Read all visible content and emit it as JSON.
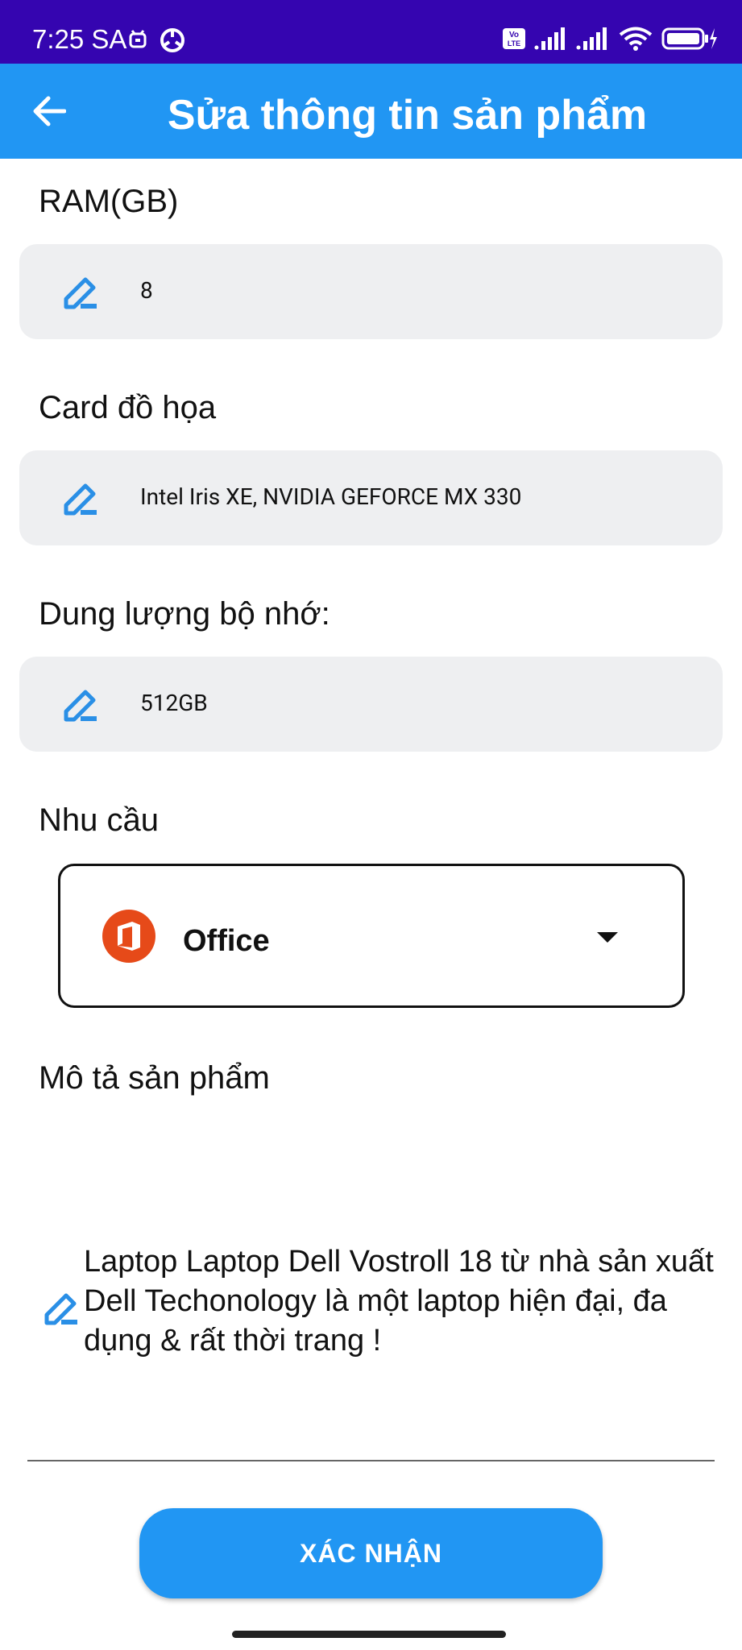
{
  "status_bar": {
    "time": "7:25 SA",
    "volte_label": "Vo\nLTE",
    "battery_icon": "battery-charging-icon",
    "colors": {
      "background": "#3505b0",
      "foreground": "#ffffff"
    }
  },
  "app_bar": {
    "title": "Sửa thông tin sản phẩm",
    "back_icon": "back-arrow-icon",
    "color": "#2196f3"
  },
  "fields": [
    {
      "label": "RAM(GB)",
      "value": "8",
      "icon": "edit-pencil-icon"
    },
    {
      "label": "Card đồ họa",
      "value": "Intel Iris XE, NVIDIA GEFORCE MX 330",
      "icon": "edit-pencil-icon"
    },
    {
      "label": "Dung lượng bộ nhớ:",
      "value": "512GB",
      "icon": "edit-pencil-icon"
    }
  ],
  "need": {
    "label": "Nhu cầu",
    "selected": "Office",
    "icon": "office-logo-icon",
    "caret_icon": "caret-down-icon"
  },
  "description": {
    "label": "Mô tả sản phẩm",
    "value": "Laptop Laptop Dell Vostroll 18 từ nhà sản xuất Dell Techonology là một laptop hiện đại, đa dụng & rất thời trang !",
    "icon": "edit-pencil-icon"
  },
  "confirm_button": {
    "label": "XÁC NHẬN",
    "color": "#2196f3"
  }
}
